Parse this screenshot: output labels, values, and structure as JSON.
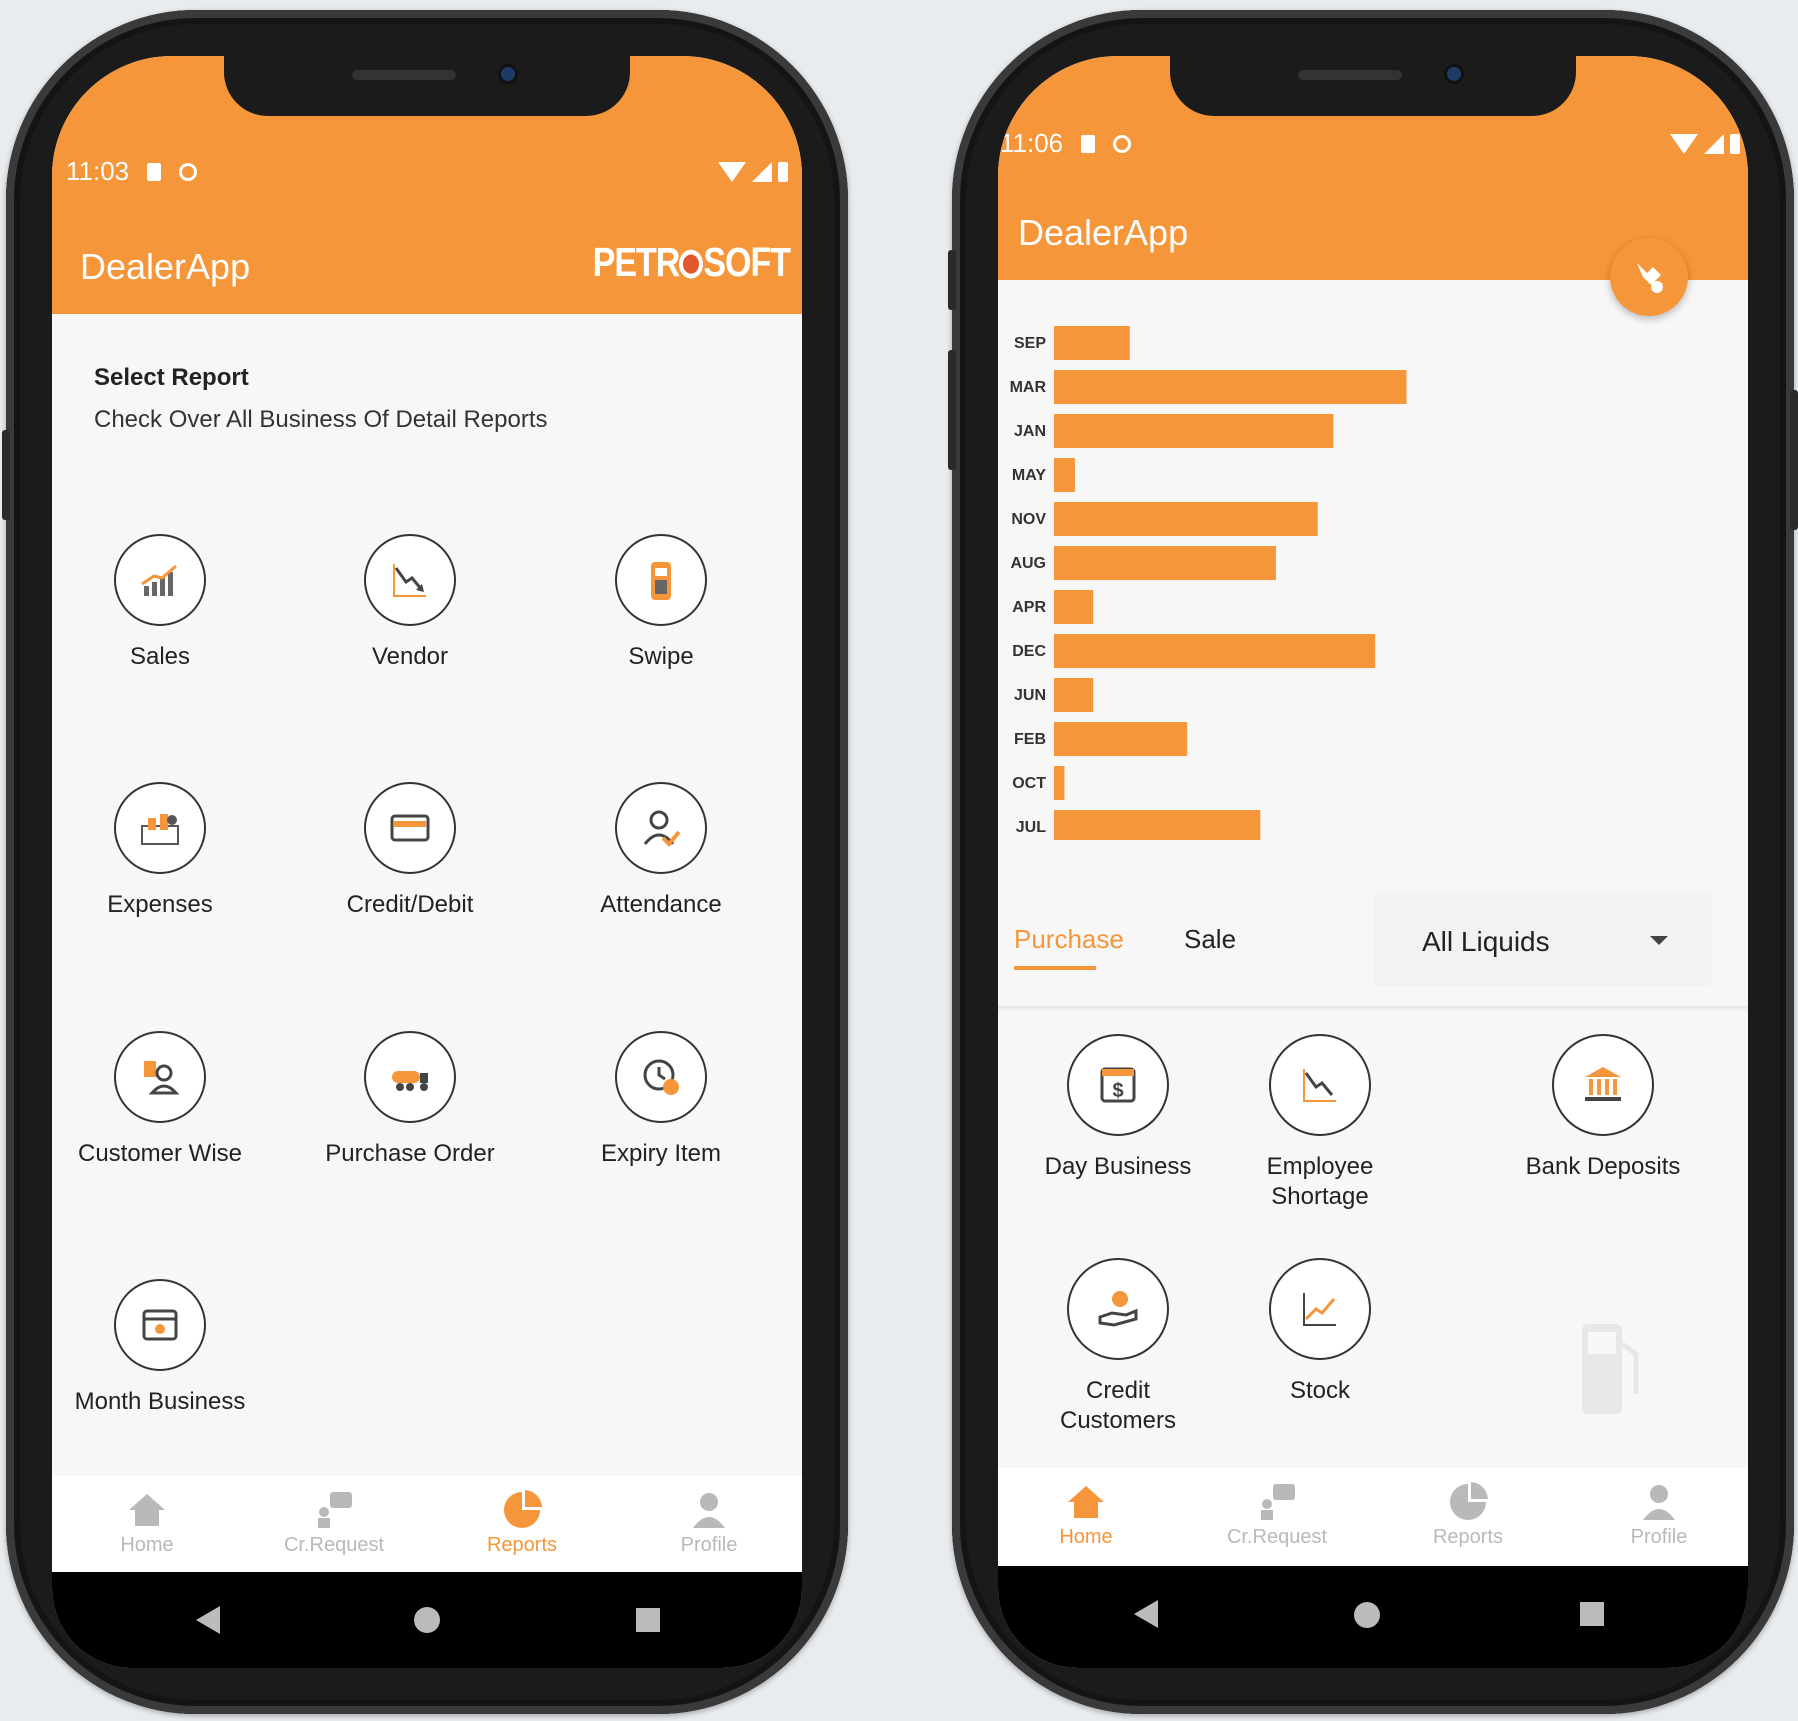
{
  "brand": {
    "accent": "#f5963a",
    "logo_text_a": "PETR",
    "logo_text_b": "SOFT"
  },
  "left_phone": {
    "status_time": "11:03",
    "app_title": "DealerApp",
    "heading": "Select Report",
    "subheading": "Check Over All Business Of Detail Reports",
    "reports": [
      {
        "label": "Sales",
        "icon": "sales-chart-icon"
      },
      {
        "label": "Vendor",
        "icon": "vendor-trend-icon"
      },
      {
        "label": "Swipe",
        "icon": "card-machine-icon"
      },
      {
        "label": "Expenses",
        "icon": "expenses-icon"
      },
      {
        "label": "Credit/Debit",
        "icon": "credit-card-icon"
      },
      {
        "label": "Attendance",
        "icon": "attendance-icon"
      },
      {
        "label": "Customer Wise",
        "icon": "customer-icon"
      },
      {
        "label": "Purchase Order",
        "icon": "tanker-truck-icon"
      },
      {
        "label": "Expiry Item",
        "icon": "clock-alert-icon"
      },
      {
        "label": "Month Business",
        "icon": "calendar-icon"
      }
    ],
    "nav": [
      {
        "label": "Home",
        "icon": "home-icon",
        "active": false
      },
      {
        "label": "Cr.Request",
        "icon": "chat-person-icon",
        "active": false
      },
      {
        "label": "Reports",
        "icon": "pie-chart-icon",
        "active": true
      },
      {
        "label": "Profile",
        "icon": "person-icon",
        "active": false
      }
    ]
  },
  "right_phone": {
    "status_time": "11:06",
    "app_title": "DealerApp",
    "tabs": {
      "purchase": "Purchase",
      "sale": "Sale",
      "active": "Purchase"
    },
    "dropdown_value": "All Liquids",
    "tiles": [
      {
        "label": "Day Business",
        "icon": "dollar-calendar-icon"
      },
      {
        "label": "Employee Shortage",
        "icon": "declining-trend-icon"
      },
      {
        "label": "Bank Deposits",
        "icon": "bank-icon"
      },
      {
        "label": "Credit Customers",
        "icon": "hand-coin-icon"
      },
      {
        "label": "Stock",
        "icon": "rising-trend-icon"
      }
    ],
    "nav": [
      {
        "label": "Home",
        "icon": "home-icon",
        "active": true
      },
      {
        "label": "Cr.Request",
        "icon": "chat-person-icon",
        "active": false
      },
      {
        "label": "Reports",
        "icon": "pie-chart-icon",
        "active": false
      },
      {
        "label": "Profile",
        "icon": "person-icon",
        "active": false
      }
    ]
  },
  "chart_data": {
    "type": "bar",
    "orientation": "horizontal",
    "categories": [
      "SEP",
      "MAR",
      "JAN",
      "MAY",
      "NOV",
      "AUG",
      "APR",
      "DEC",
      "JUN",
      "FEB",
      "OCT",
      "JUL"
    ],
    "values": [
      345000,
      451000,
      423000,
      324000,
      417000,
      401000,
      331000,
      439000,
      331000,
      367000,
      320000,
      395000
    ],
    "xlim": [
      316000,
      532000
    ],
    "xticks": [
      "320,000",
      "360,000",
      "400,000",
      "440,000",
      "480,000",
      "520,000"
    ],
    "xtick_values": [
      320000,
      360000,
      400000,
      440000,
      480000,
      520000
    ],
    "grid": false,
    "bar_color": "#f5963a"
  }
}
